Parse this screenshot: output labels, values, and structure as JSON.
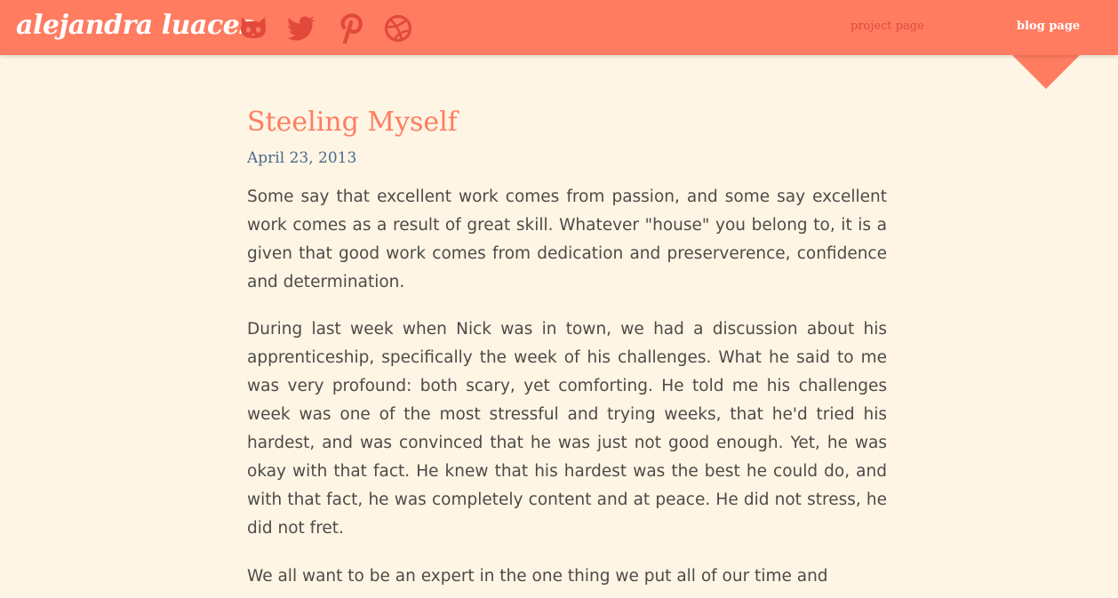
{
  "header": {
    "logo": "alejandra luaces",
    "social": [
      {
        "icon": "github-icon",
        "label": "GitHub"
      },
      {
        "icon": "twitter-icon",
        "label": "Twitter"
      },
      {
        "icon": "pinterest-icon",
        "label": "Pinterest"
      },
      {
        "icon": "dribbble-icon",
        "label": "Dribbble"
      }
    ],
    "nav": {
      "project": "project page",
      "blog": "blog page"
    },
    "active_nav": "blog page"
  },
  "post": {
    "title": "Steeling Myself",
    "date": "April 23, 2013",
    "paragraphs": [
      "Some say that excellent work comes from passion, and some say excellent work comes as a result of great skill. Whatever \"house\" you belong to, it is a given that good work comes from dedication and preserverence, confidence and determination.",
      "During last week when Nick was in town, we had a discussion about his apprenticeship, specifically the week of his challenges. What he said to me was very profound: both scary, yet comforting. He told me his challenges week was one of the most stressful and trying weeks, that he'd tried his hardest, and was convinced that he was just not good enough. Yet, he was okay with that fact. He knew that his hardest was the best he could do, and with that fact, he was completely content and at peace. He did not stress, he did not fret.",
      "We all want to be an expert in the one thing we put all of our time and"
    ]
  },
  "colors": {
    "header_bg": "#ff7c61",
    "page_bg": "#fef5e4",
    "title": "#ff7c61",
    "date": "#4d6a8c",
    "body_text": "#4d4a48",
    "icon": "#e2493b",
    "nav_inactive": "#e2493b",
    "nav_active": "#ffffff"
  }
}
